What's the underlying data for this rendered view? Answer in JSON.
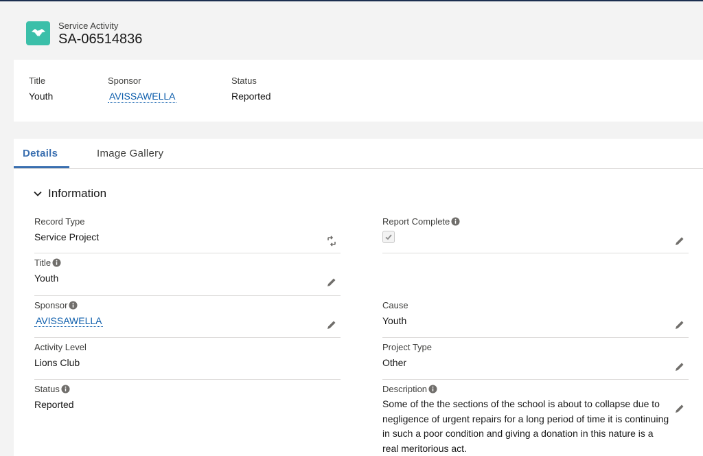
{
  "header": {
    "icon": "handshake-icon",
    "icon_color": "#3bbfa9",
    "object_label": "Service Activity",
    "record_name": "SA-06514836"
  },
  "highlights": {
    "title_label": "Title",
    "title_value": "Youth",
    "sponsor_label": "Sponsor",
    "sponsor_value": "AVISSAWELLA",
    "status_label": "Status",
    "status_value": "Reported"
  },
  "tabs": [
    {
      "label": "Details",
      "active": true
    },
    {
      "label": "Image Gallery",
      "active": false
    }
  ],
  "section": {
    "title": "Information",
    "expanded": true
  },
  "fields": {
    "record_type": {
      "label": "Record Type",
      "value": "Service Project"
    },
    "title": {
      "label": "Title",
      "value": "Youth"
    },
    "sponsor": {
      "label": "Sponsor",
      "value": "AVISSAWELLA"
    },
    "activity_level": {
      "label": "Activity Level",
      "value": "Lions Club"
    },
    "status": {
      "label": "Status",
      "value": "Reported"
    },
    "report_complete": {
      "label": "Report Complete",
      "checked": true
    },
    "cause": {
      "label": "Cause",
      "value": "Youth"
    },
    "project_type": {
      "label": "Project Type",
      "value": "Other"
    },
    "description": {
      "label": "Description",
      "value": "Some of the the sections of the school is about to collapse due to negligence of urgent repairs for a long period of time it is continuing in such a poor condition and giving a donation in this nature is a real meritorious act."
    }
  },
  "colors": {
    "link": "#0b5cab",
    "tab_active": "#3a6fb0",
    "icon": "#706e6b"
  }
}
